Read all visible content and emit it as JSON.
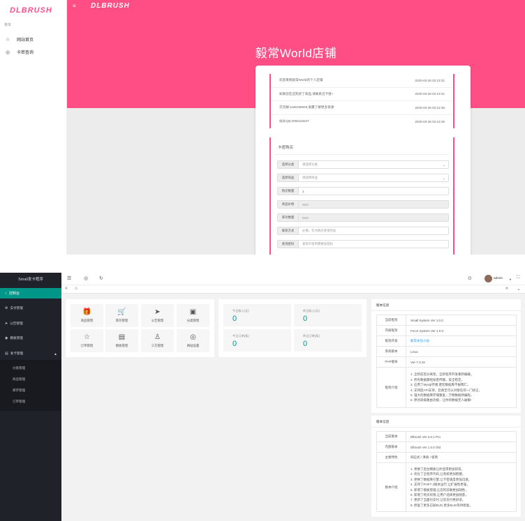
{
  "shop": {
    "sidebar": {
      "logo": "DLBRUSH",
      "menu_caption": "菜单",
      "items": [
        {
          "icon": "home-icon",
          "label": "网站首页"
        },
        {
          "icon": "globe-icon",
          "label": "卡密查询"
        }
      ]
    },
    "header": {
      "logo": "DLBRUSH",
      "title": "毅常World店铺"
    },
    "notices": [
      {
        "text": "欢迎来到毅常World的个人店铺",
        "time": "2020-03-26 02:13:31"
      },
      {
        "text": "如果您在这购买了商品,请联系这卡授~",
        "time": "2020-03-26 02:13:31"
      },
      {
        "text": "交流群:1158199849,进赢了解更多资源",
        "time": "2020-03-26 02:13:35"
      },
      {
        "text": "站长QQ:2050119427",
        "time": "2020-03-26 02:13:45"
      }
    ],
    "buy": {
      "title": "卡密购买",
      "fields": [
        {
          "label": "选择分类",
          "value": "请选择分类",
          "type": "select"
        },
        {
          "label": "选择商品",
          "value": "请选择商品",
          "type": "select"
        },
        {
          "label": "购买数量",
          "value": "1",
          "type": "input"
        },
        {
          "label": "商品价格",
          "value": "NaN",
          "type": "readonly"
        },
        {
          "label": "库存数量",
          "value": "NaN",
          "type": "readonly"
        },
        {
          "label": "联系方式",
          "value": "必填，作为购买查询凭证",
          "type": "input"
        },
        {
          "label": "查询密码",
          "value": "查询卡密时需要该密码",
          "type": "input"
        }
      ]
    }
  },
  "admin": {
    "sidebar": {
      "brand": "Small发卡程序",
      "active": "控制台",
      "items": [
        "支付管理",
        "公告管理",
        "模板管理",
        "发卡管理"
      ],
      "sub_items": [
        "分类管理",
        "商品管理",
        "库存管理",
        "订单管理"
      ]
    },
    "user": "admin",
    "quick": [
      {
        "icon": "gift-icon",
        "glyph": "🎁",
        "label": "商品管理"
      },
      {
        "icon": "cart-icon",
        "glyph": "🛒",
        "label": "库存管理"
      },
      {
        "icon": "send-icon",
        "glyph": "➤",
        "label": "公告管理"
      },
      {
        "icon": "box-icon",
        "glyph": "▣",
        "label": "分类管理"
      },
      {
        "icon": "star-icon",
        "glyph": "☆",
        "label": "订单管理"
      },
      {
        "icon": "template-icon",
        "glyph": "▤",
        "label": "模板管理"
      },
      {
        "icon": "user-icon",
        "glyph": "♙",
        "label": "三方管理"
      },
      {
        "icon": "globe-icon",
        "glyph": "◎",
        "label": "网站设置"
      }
    ],
    "stats": [
      {
        "label": "今日收入(元)",
        "value": "0"
      },
      {
        "label": "昨日收入(元)",
        "value": "0"
      },
      {
        "label": "今日订单(条)",
        "value": "0"
      },
      {
        "label": "昨日订单(条)",
        "value": "0"
      }
    ],
    "version_panel": {
      "title": "版本信息",
      "rows": [
        {
          "k": "当前框架",
          "v": "Small System Ver 1.0.0"
        },
        {
          "k": "内核框架",
          "v": "Force System Ver 1.0.0"
        },
        {
          "k": "框架开发",
          "v": "毅常永恒小站"
        },
        {
          "k": "系统版本",
          "v": "Linux"
        },
        {
          "k": "PHP版本",
          "v": "Ver-7.3.18"
        }
      ],
      "intro_key": "框架介绍",
      "intro": [
        "1. 全新前后分离架，全新程序开发重新编载，",
        "2. 所有数据都经加密传输，安全稳定，",
        "3. 应用了Mysql存储,使您数据库不报两仁，",
        "4. 支持后API支持，您真至可以对接任何一门语言，",
        "5. 强大的数据库存储重复，万物数据待编程，",
        "6. 原创高级路由功能，让你的数据无人破解!"
      ]
    },
    "program_panel": {
      "title": "版本信息",
      "rows": [
        {
          "k": "当前版本",
          "v": "Dlbrush Ver 2.0.1 Pro"
        },
        {
          "k": "内部版本",
          "v": "Dlbrush Ver 1.0.0 Old"
        },
        {
          "k": "主要特色",
          "v": "响应式 / 清爽 / 极简"
        }
      ],
      "intro_key": "版本介绍",
      "intro": [
        "1. 更换了后台模板让你显得更加舒适，",
        "2. 优化了全程序代码,让系统更加稳健，",
        "3. 更换了数据库引擎,让卡密速度更加迅速，",
        "4. 支持了PHP7.3版本运行,让扩展性更强，",
        "5. 新增了模板管理,让您的前端更加随性，",
        "6. 新增了购买权限,让用户选择更加随意，",
        "7. 更新了当面付支付,让您支付更舒适，",
        "8. 修复了更多已知BUG,更多BUG等待修复。"
      ]
    }
  }
}
